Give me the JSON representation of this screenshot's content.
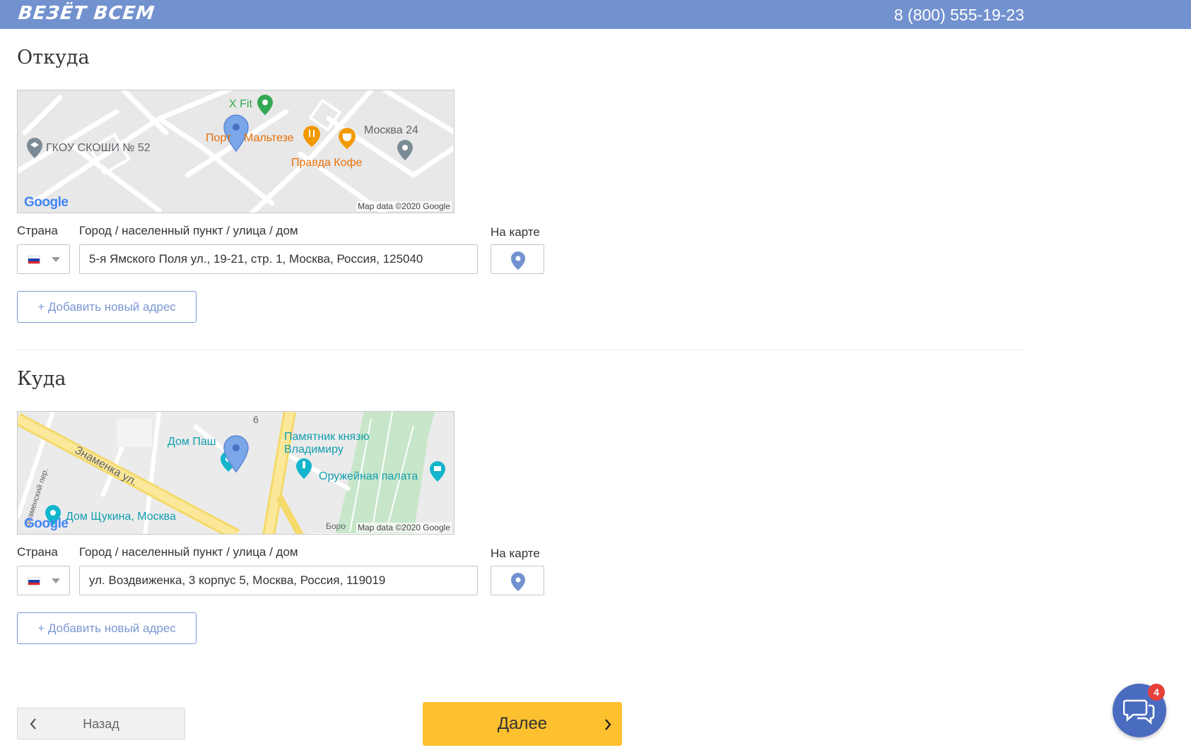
{
  "header": {
    "logo": "ВЕЗЁТ ВСЕМ",
    "phone": "8 (800) 555-19-23"
  },
  "from": {
    "title": "Откуда",
    "map": {
      "labels": {
        "xfit": "X Fit",
        "port": "Порт",
        "maltese": "Мальтезе",
        "moskva24": "Москва 24",
        "school": "ГКОУ СКОШИ № 52",
        "pravda": "Правда Кофе"
      },
      "google": "Google",
      "attribution": "Map data ©2020 Google"
    },
    "country_label": "Страна",
    "address_label": "Город / населенный пункт / улица / дом",
    "on_map_label": "На карте",
    "address_value": "5-я Ямского Поля ул., 19-21, стр. 1, Москва, Россия, 125040",
    "add_address": "+ Добавить новый адрес"
  },
  "to": {
    "title": "Куда",
    "map": {
      "labels": {
        "route6": "6",
        "dom_pash": "Дом Паш",
        "znamenka": "Знаменка ул.",
        "znamensky": "Знаменский пер.",
        "monument": "Памятник князю",
        "monument2": "Владимиру",
        "armory": "Оружейная палата",
        "shchukin": "Дом Щукина, Москва",
        "boro": "Боро"
      },
      "google": "Google",
      "attribution": "Map data ©2020 Google"
    },
    "country_label": "Страна",
    "address_label": "Город / населенный пункт / улица / дом",
    "on_map_label": "На карте",
    "address_value": "ул. Воздвиженка, 3 корпус 5, Москва, Россия, 119019",
    "add_address": "+ Добавить новый адрес"
  },
  "nav": {
    "back": "Назад",
    "next": "Далее"
  },
  "chat": {
    "badge": "4"
  },
  "colors": {
    "header": "#7291cf",
    "accent_button": "#fdc02f",
    "link_blue": "#7a98d4",
    "chat": "#4a6cc0"
  }
}
